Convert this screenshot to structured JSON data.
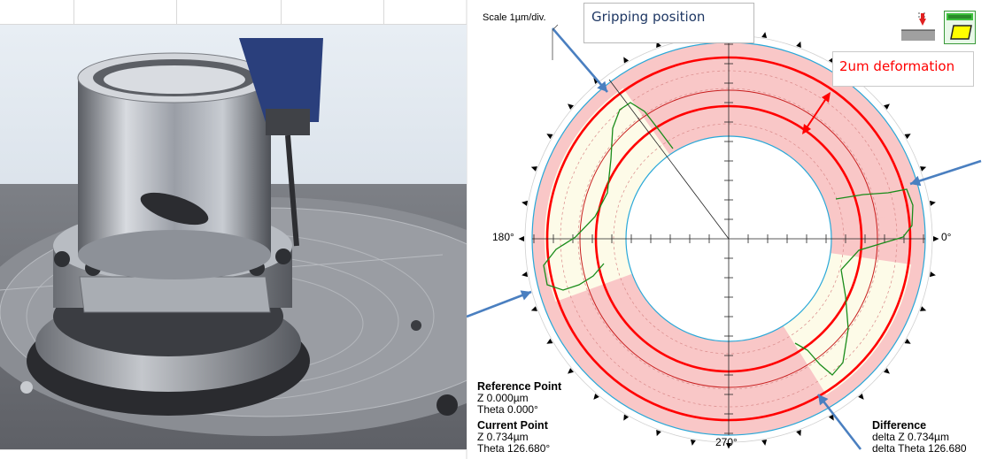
{
  "scale_label": "Scale 1µm/div.",
  "gripping_label": "Gripping position",
  "deformation_label": "2um deformation",
  "angles": {
    "a180": "180°",
    "a0": "0°",
    "a270": "270°"
  },
  "reference": {
    "title": "Reference Point",
    "z": "Z 0.000µm",
    "theta": "Theta 0.000°"
  },
  "current": {
    "title": "Current Point",
    "z": "Z 0.734µm",
    "theta": "Theta 126.680°"
  },
  "difference": {
    "title": "Difference",
    "delta_z": "delta Z 0.734µm",
    "delta_theta": "delta Theta 126.680"
  },
  "icons": {
    "measure": "measure-mode-icon",
    "level": "level-icon"
  },
  "colors": {
    "band": "#f9c7c7",
    "pale": "#fdfbe8",
    "red": "#ff0000",
    "green": "#1a8c1a",
    "blue": "#4a7fc0",
    "cyan": "#29a8d8"
  }
}
